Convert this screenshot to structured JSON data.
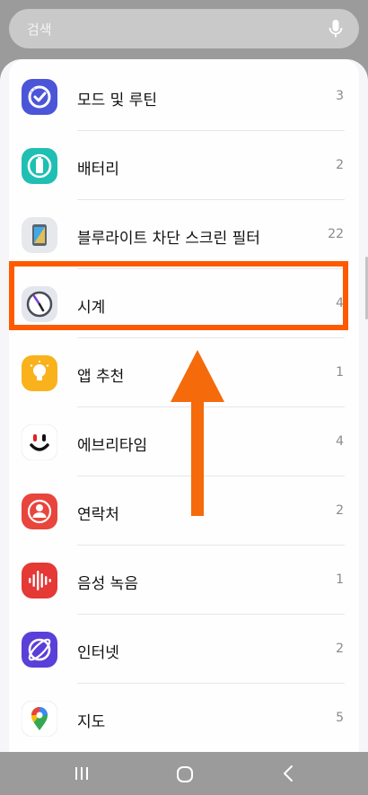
{
  "search": {
    "placeholder": "검색"
  },
  "apps": [
    {
      "label": "모드 및 루틴",
      "count": "3",
      "icon": "modes-routines-icon"
    },
    {
      "label": "배터리",
      "count": "2",
      "icon": "battery-icon"
    },
    {
      "label": "블루라이트 차단 스크린 필터",
      "count": "22",
      "icon": "blue-light-filter-icon"
    },
    {
      "label": "시계",
      "count": "4",
      "icon": "clock-icon"
    },
    {
      "label": "앱 추천",
      "count": "1",
      "icon": "app-recommendation-icon"
    },
    {
      "label": "에브리타임",
      "count": "4",
      "icon": "everytime-icon"
    },
    {
      "label": "연락처",
      "count": "2",
      "icon": "contacts-icon"
    },
    {
      "label": "음성 녹음",
      "count": "1",
      "icon": "voice-recorder-icon"
    },
    {
      "label": "인터넷",
      "count": "2",
      "icon": "internet-icon"
    },
    {
      "label": "지도",
      "count": "5",
      "icon": "maps-icon"
    }
  ],
  "highlight": {
    "target": "시계",
    "color": "#ff5a00"
  }
}
